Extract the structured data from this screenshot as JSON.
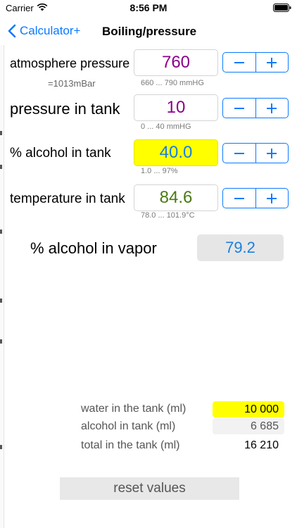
{
  "status_bar": {
    "carrier": "Carrier",
    "time": "8:56 PM"
  },
  "nav": {
    "back_label": "Calculator+",
    "title": "Boiling/pressure"
  },
  "rows": [
    {
      "label": "atmosphere pressure",
      "value": "760",
      "hint": "660 ... 790 mmHG",
      "note": "=1013mBar",
      "value_color": "#8b008b",
      "value_bg": "#ffffff"
    },
    {
      "label": "pressure in tank",
      "value": "10",
      "hint": "0 ... 40 mmHG",
      "value_color": "#8b008b",
      "value_bg": "#ffffff"
    },
    {
      "label": "% alcohol in tank",
      "value": "40.0",
      "hint": "1.0 ... 97%",
      "value_color": "#1a7fe0",
      "value_bg": "#ffff00"
    },
    {
      "label": "temperature in tank",
      "value": "84.6",
      "hint": "78.0 ... 101.9°C",
      "value_color": "#4a7a12",
      "value_bg": "#ffffff"
    }
  ],
  "vapor": {
    "label": "% alcohol in vapor",
    "value": "79.2"
  },
  "summary": [
    {
      "label": "water in the tank (ml)",
      "value": "10 000",
      "bg": "#ffff00"
    },
    {
      "label": "alcohol in tank (ml)",
      "value": "6 685",
      "bg": "#f2f2f2"
    },
    {
      "label": "total in the tank (ml)",
      "value": "16 210",
      "bg": "#ffffff"
    }
  ],
  "reset_label": "reset values",
  "colors": {
    "accent": "#0a7aff"
  }
}
